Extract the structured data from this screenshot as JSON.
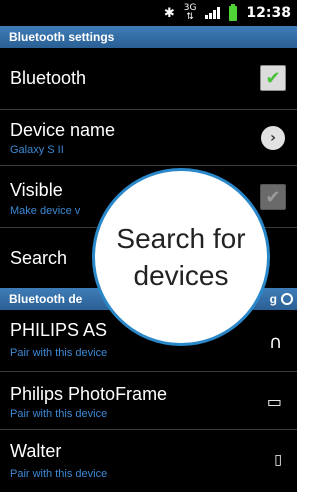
{
  "status_bar": {
    "bluetooth_icon": "bluetooth-icon",
    "network": "3G",
    "signal_icon": "signal-icon",
    "battery_icon": "battery-icon",
    "time": "12:38"
  },
  "header": {
    "title": "Bluetooth settings"
  },
  "settings": {
    "bluetooth": {
      "label": "Bluetooth",
      "checked": true
    },
    "device_name": {
      "label": "Device name",
      "value": "Galaxy S II"
    },
    "visible": {
      "label": "Visible",
      "subtitle": "Make device v",
      "checked": true
    },
    "search": {
      "label": "Search"
    }
  },
  "devices_section": {
    "title": "Bluetooth de",
    "status": "g"
  },
  "devices": [
    {
      "name": "PHILIPS AS",
      "subtitle": "Pair with this device",
      "icon": "headphones-icon"
    },
    {
      "name": "Philips PhotoFrame",
      "subtitle": "Pair with this device",
      "icon": "laptop-icon"
    },
    {
      "name": "Walter",
      "subtitle": "Pair with this device",
      "icon": "phone-icon"
    }
  ],
  "callout": {
    "line1": "Search for",
    "line2": "devices"
  },
  "colors": {
    "accent_blue": "#3d89d6",
    "header_blue": "#3f7db8",
    "check_green": "#49c13a",
    "bubble_border": "#2a88c9"
  }
}
